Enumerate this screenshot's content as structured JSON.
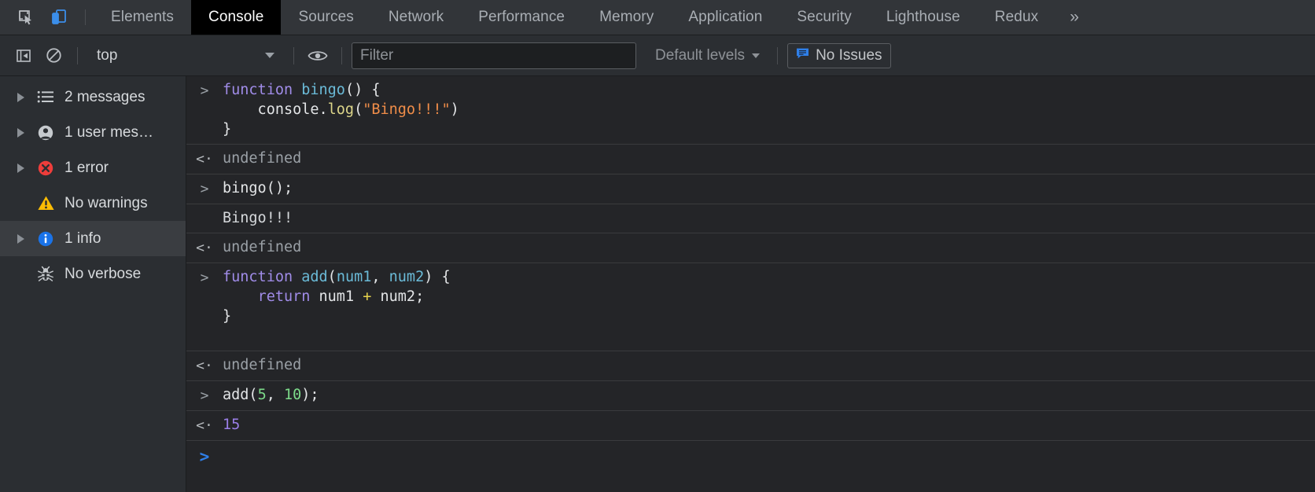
{
  "window": {
    "title": "Chrome DevTools — Console"
  },
  "tabbar": {
    "inspect_icon": "inspect-element-icon",
    "device_icon": "device-toolbar-icon",
    "tabs": [
      {
        "label": "Elements",
        "active": false
      },
      {
        "label": "Console",
        "active": true
      },
      {
        "label": "Sources",
        "active": false
      },
      {
        "label": "Network",
        "active": false
      },
      {
        "label": "Performance",
        "active": false
      },
      {
        "label": "Memory",
        "active": false
      },
      {
        "label": "Application",
        "active": false
      },
      {
        "label": "Security",
        "active": false
      },
      {
        "label": "Lighthouse",
        "active": false
      },
      {
        "label": "Redux",
        "active": false
      }
    ],
    "overflow_label": "»"
  },
  "toolbar": {
    "sidebar_toggle_icon": "console-sidebar-toggle-icon",
    "clear_icon": "clear-console-icon",
    "context_value": "top",
    "eye_icon": "create-live-expression-icon",
    "filter_placeholder": "Filter",
    "filter_value": "",
    "levels_label": "Default levels",
    "issues_label": "No Issues",
    "issues_icon": "issues-message-icon",
    "issues_icon_color": "#2f7fe8"
  },
  "sidebar": {
    "items": [
      {
        "label": "2 messages",
        "icon": "list-icon",
        "expandable": true,
        "selected": false
      },
      {
        "label": "1 user mes…",
        "icon": "person-icon",
        "expandable": true,
        "selected": false
      },
      {
        "label": "1 error",
        "icon": "error-icon",
        "expandable": true,
        "selected": false
      },
      {
        "label": "No warnings",
        "icon": "warning-icon",
        "expandable": false,
        "selected": false
      },
      {
        "label": "1 info",
        "icon": "info-icon",
        "expandable": true,
        "selected": true
      },
      {
        "label": "No verbose",
        "icon": "bug-icon",
        "expandable": false,
        "selected": false
      }
    ],
    "colors": {
      "error": "#ee3d3b",
      "warning": "#fbbc04",
      "info": "#1a73e8",
      "neutral": "#bdc1c6"
    }
  },
  "console": {
    "prompt_in": ">",
    "prompt_out": "<·",
    "messages": [
      {
        "kind": "input",
        "lines": [
          [
            {
              "t": "function ",
              "c": "kw"
            },
            {
              "t": "bingo",
              "c": "fn"
            },
            {
              "t": "() {",
              "c": "plain"
            }
          ],
          [
            {
              "t": "    console.",
              "c": "plain"
            },
            {
              "t": "log",
              "c": "meth"
            },
            {
              "t": "(",
              "c": "plain"
            },
            {
              "t": "\"Bingo!!!\"",
              "c": "str"
            },
            {
              "t": ")",
              "c": "plain"
            }
          ],
          [
            {
              "t": "}",
              "c": "plain"
            }
          ]
        ]
      },
      {
        "kind": "result",
        "lines": [
          [
            {
              "t": "undefined",
              "c": "undef"
            }
          ]
        ]
      },
      {
        "kind": "input",
        "lines": [
          [
            {
              "t": "bingo();",
              "c": "plain"
            }
          ]
        ]
      },
      {
        "kind": "log",
        "lines": [
          [
            {
              "t": "Bingo!!!",
              "c": "out"
            }
          ]
        ]
      },
      {
        "kind": "result",
        "lines": [
          [
            {
              "t": "undefined",
              "c": "undef"
            }
          ]
        ]
      },
      {
        "kind": "input",
        "lines": [
          [
            {
              "t": "function ",
              "c": "kw"
            },
            {
              "t": "add",
              "c": "fn"
            },
            {
              "t": "(",
              "c": "plain"
            },
            {
              "t": "num1",
              "c": "prm"
            },
            {
              "t": ", ",
              "c": "plain"
            },
            {
              "t": "num2",
              "c": "prm"
            },
            {
              "t": ") {",
              "c": "plain"
            }
          ],
          [
            {
              "t": "    ",
              "c": "plain"
            },
            {
              "t": "return ",
              "c": "kw"
            },
            {
              "t": "num1 ",
              "c": "plain"
            },
            {
              "t": "+",
              "c": "op"
            },
            {
              "t": " num2;",
              "c": "plain"
            }
          ],
          [
            {
              "t": "}",
              "c": "plain"
            }
          ],
          [
            {
              "t": " ",
              "c": "plain"
            }
          ]
        ]
      },
      {
        "kind": "result",
        "lines": [
          [
            {
              "t": "undefined",
              "c": "undef"
            }
          ]
        ]
      },
      {
        "kind": "input",
        "lines": [
          [
            {
              "t": "add(",
              "c": "plain"
            },
            {
              "t": "5",
              "c": "num"
            },
            {
              "t": ", ",
              "c": "plain"
            },
            {
              "t": "10",
              "c": "num"
            },
            {
              "t": ");",
              "c": "plain"
            }
          ]
        ]
      },
      {
        "kind": "result",
        "lines": [
          [
            {
              "t": "15",
              "c": "res"
            }
          ]
        ]
      },
      {
        "kind": "prompt",
        "lines": [
          [
            {
              "t": "",
              "c": "plain"
            }
          ]
        ]
      }
    ]
  }
}
